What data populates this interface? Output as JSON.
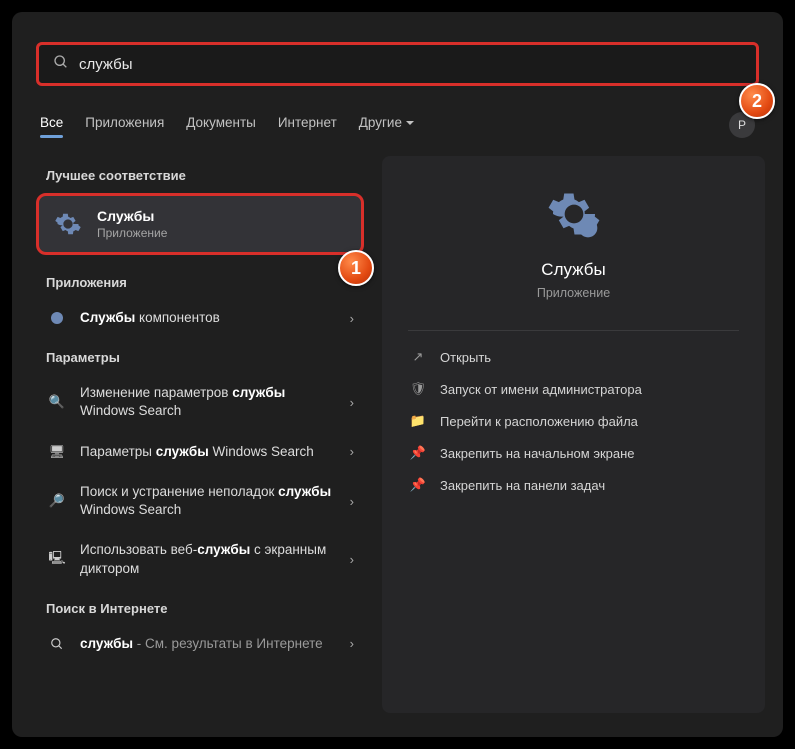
{
  "search": {
    "value": "службы"
  },
  "tabs": {
    "items": [
      "Все",
      "Приложения",
      "Документы",
      "Интернет",
      "Другие"
    ],
    "active": 0
  },
  "userInitial": "P",
  "sections": {
    "bestMatch": "Лучшее соответствие",
    "apps": "Приложения",
    "settings": "Параметры",
    "web": "Поиск в Интернете"
  },
  "bestMatch": {
    "title": "Службы",
    "subtitle": "Приложение"
  },
  "appsResults": [
    {
      "pre": "Службы",
      "post": " компонентов",
      "bold": "Службы"
    }
  ],
  "settingsResults": [
    {
      "html": "Изменение параметров <b>службы</b> Windows Search"
    },
    {
      "html": "Параметры <b>службы</b> Windows Search"
    },
    {
      "html": "Поиск и устранение неполадок <b>службы</b> Windows Search"
    },
    {
      "html": "Использовать веб-<b>службы</b> с экранным диктором"
    }
  ],
  "webResults": [
    {
      "pre": "службы",
      "post": " - См. результаты в Интернете"
    }
  ],
  "detail": {
    "title": "Службы",
    "subtitle": "Приложение",
    "actions": [
      {
        "icon": "open",
        "label": "Открыть"
      },
      {
        "icon": "admin",
        "label": "Запуск от имени администратора"
      },
      {
        "icon": "folder",
        "label": "Перейти к расположению файла"
      },
      {
        "icon": "pin",
        "label": "Закрепить на начальном экране"
      },
      {
        "icon": "pin",
        "label": "Закрепить на панели задач"
      }
    ]
  },
  "badges": {
    "b1": "1",
    "b2": "2"
  }
}
